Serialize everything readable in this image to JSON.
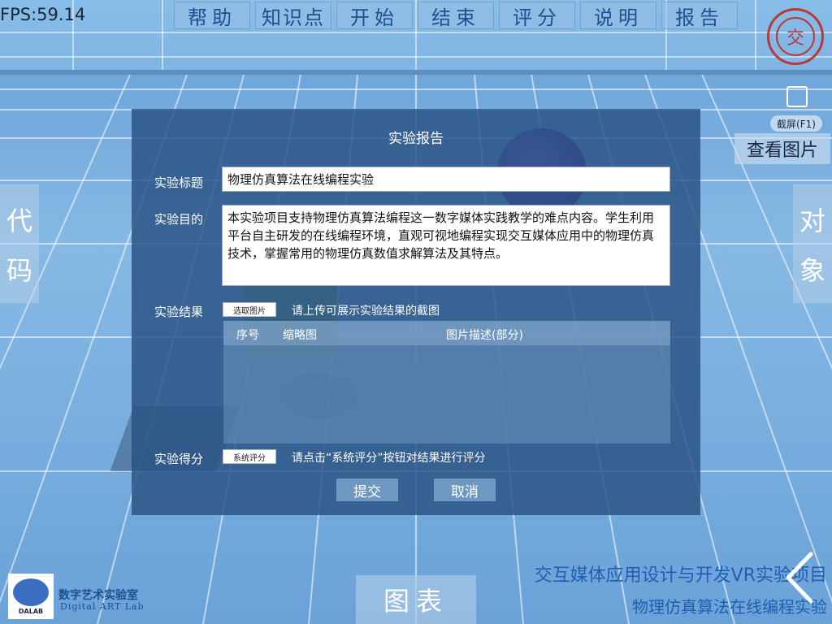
{
  "status": {
    "fps": "FPS:59.14"
  },
  "topnav": [
    {
      "label": "帮助"
    },
    {
      "label": "知识点"
    },
    {
      "label": "开始"
    },
    {
      "label": "结束"
    },
    {
      "label": "评分"
    },
    {
      "label": "说明"
    },
    {
      "label": "报告"
    }
  ],
  "logo": {
    "glyph": "交"
  },
  "screenshot": {
    "label": "截屏(F1)",
    "icon": "screenshot-icon"
  },
  "view_images": {
    "label": "查看图片"
  },
  "side_left": {
    "chars": [
      "代",
      "码"
    ]
  },
  "side_right": {
    "chars": [
      "对",
      "象"
    ]
  },
  "report": {
    "title": "实验报告",
    "title_label": "实验标题",
    "title_value": "物理仿真算法在线编程实验",
    "purpose_label": "实验目的",
    "purpose_value": "本实验项目支持物理仿真算法编程这一数字媒体实践教学的难点内容。学生利用平台自主研发的在线编程环境，直观可视地编程实现交互媒体应用中的物理仿真技术，掌握常用的物理仿真数值求解算法及其特点。",
    "result_label": "实验结果",
    "select_image_button": "选取图片",
    "result_hint": "请上传可展示实验结果的截图",
    "table_headers": [
      "序号",
      "缩略图",
      "图片描述(部分)"
    ],
    "score_label": "实验得分",
    "system_score_button": "系统评分",
    "score_hint": "请点击“系统评分”按钮对结果进行评分",
    "submit_button": "提交",
    "cancel_button": "取消"
  },
  "lab": {
    "logo_text": "DALAB",
    "name_cn": "数字艺术实验室",
    "name_en": "Digital ART Lab"
  },
  "chart_button": "图表",
  "footer": {
    "course_title": "交互媒体应用设计与开发VR实验项目",
    "experiment_title": "物理仿真算法在线编程实验"
  }
}
